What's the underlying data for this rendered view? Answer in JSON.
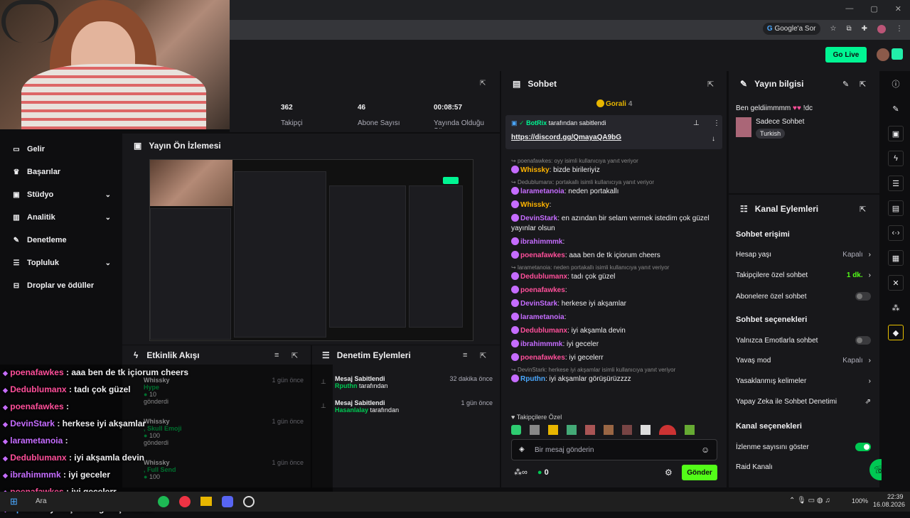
{
  "browser": {
    "search_label": "Google'a Sor",
    "window_icons": [
      "minimize",
      "maximize",
      "close"
    ]
  },
  "header": {
    "go_live": "Go Live"
  },
  "sidebar": {
    "items": [
      {
        "label": "Gelir",
        "icon": "dollar-icon",
        "chev": false
      },
      {
        "label": "Başarılar",
        "icon": "trophy-icon",
        "chev": false
      },
      {
        "label": "Stüdyo",
        "icon": "studio-icon",
        "chev": true
      },
      {
        "label": "Analitik",
        "icon": "chart-icon",
        "chev": true
      },
      {
        "label": "Denetleme",
        "icon": "wrench-icon",
        "chev": false
      },
      {
        "label": "Topluluk",
        "icon": "users-icon",
        "chev": true
      },
      {
        "label": "Droplar ve ödüller",
        "icon": "gift-icon",
        "chev": false
      }
    ]
  },
  "stats": {
    "followers": {
      "value": "362",
      "label": "Takipçi"
    },
    "subs": {
      "value": "46",
      "label": "Abone Sayısı"
    },
    "live": {
      "value": "00:08:57",
      "label": "Yayında Olduğu Süre"
    }
  },
  "preview": {
    "title": "Yayın Ön İzlemesi"
  },
  "activity": {
    "title": "Etkinlik Akışı",
    "items": [
      {
        "user": "Whissky",
        "time": "1 gün önce",
        "sub": "Hype",
        "amount": "10",
        "tail": "gönderdi"
      },
      {
        "user": "Whissky",
        "time": "1 gün önce",
        "sub": ", Skull Emoji",
        "amount": "100",
        "tail": "gönderdi"
      },
      {
        "user": "Whissky",
        "time": "1 gün önce",
        "sub": ", Full Send",
        "amount": "100",
        "tail": ""
      }
    ]
  },
  "modlog": {
    "title": "Denetim Eylemleri",
    "items": [
      {
        "title": "Mesaj Sabitlendi",
        "user": "Rputhn",
        "suffix": "tarafından",
        "time": "32 dakika önce"
      },
      {
        "title": "Mesaj Sabitlendi",
        "user": "Hasanlalay",
        "suffix": "tarafından",
        "time": "1 gün önce"
      }
    ]
  },
  "overlay_chat": [
    {
      "user": "poenafawkes",
      "color": "#ff4f9a",
      "text": ": aaa ben de tk içiorum cheers"
    },
    {
      "user": "Dedublumanx",
      "color": "#ff4f9a",
      "text": ": tadı çok güzel"
    },
    {
      "user": "poenafawkes",
      "color": "#ff4f9a",
      "text": ":"
    },
    {
      "user": "DevinStark",
      "color": "#c56cff",
      "text": ": herkese iyi akşamlar"
    },
    {
      "user": "larametanoia",
      "color": "#c56cff",
      "text": ":"
    },
    {
      "user": "Dedublumanx",
      "color": "#ff4f9a",
      "text": ": iyi akşamla devin"
    },
    {
      "user": "ibrahimmmk",
      "color": "#c56cff",
      "text": ": iyi geceler"
    },
    {
      "user": "poenafawkes",
      "color": "#ff4f9a",
      "text": ": iyi gecelerr"
    },
    {
      "user": "Rputhn",
      "color": "#4aa8ff",
      "text": ": iyi akşamlar görüşürüzzzz"
    }
  ],
  "chat": {
    "title": "Sohbet",
    "gorali": "Gorali",
    "gorali_count": "4",
    "pinned_by": "BotRix",
    "pinned_suffix": "tarafından sabitlendi",
    "pinned_link": "https://discord.gg/QmayaQA9bG",
    "messages": [
      {
        "reply": "poenafawkes: oyy isimli kullanıcıya yanıt veriyor",
        "user": "",
        "text": "",
        "color": "#fff"
      },
      {
        "reply": "",
        "user": "Whissky",
        "text": ": bizde birileriyiz",
        "color": "#ffb400"
      },
      {
        "reply": "Dedublumanx: portakallı isimli kullanıcıya yanıt veriyor",
        "user": "",
        "text": "",
        "color": "#fff"
      },
      {
        "reply": "",
        "user": "larametanoia",
        "text": ": neden portakallı",
        "color": "#c56cff"
      },
      {
        "reply": "",
        "user": "Whissky",
        "text": ":",
        "color": "#ffb400"
      },
      {
        "reply": "",
        "user": "DevinStark",
        "text": ": en azından bir selam vermek istedim çok güzel yayınlar olsun",
        "color": "#c56cff"
      },
      {
        "reply": "",
        "user": "ibrahimmmk",
        "text": ":",
        "color": "#c56cff"
      },
      {
        "reply": "",
        "user": "poenafawkes",
        "text": ": aaa ben de tk içiorum cheers",
        "color": "#ff4f9a"
      },
      {
        "reply": "larametanoia: neden portakallı isimli kullanıcıya yanıt veriyor",
        "user": "",
        "text": "",
        "color": "#fff"
      },
      {
        "reply": "",
        "user": "Dedublumanx",
        "text": ": tadı çok güzel",
        "color": "#ff4f9a"
      },
      {
        "reply": "",
        "user": "poenafawkes",
        "text": ":",
        "color": "#ff4f9a"
      },
      {
        "reply": "",
        "user": "DevinStark",
        "text": ": herkese iyi akşamlar",
        "color": "#c56cff"
      },
      {
        "reply": "",
        "user": "larametanoia",
        "text": ":",
        "color": "#c56cff"
      },
      {
        "reply": "",
        "user": "Dedublumanx",
        "text": ": iyi akşamla devin",
        "color": "#ff4f9a"
      },
      {
        "reply": "",
        "user": "ibrahimmmk",
        "text": ": iyi geceler",
        "color": "#c56cff"
      },
      {
        "reply": "",
        "user": "poenafawkes",
        "text": ": iyi gecelerr",
        "color": "#ff4f9a"
      },
      {
        "reply": "DevinStark: herkese iyi akşamlar isimli kullanıcıya yanıt veriyor",
        "user": "",
        "text": "",
        "color": "#fff"
      },
      {
        "reply": "",
        "user": "Rputhn",
        "text": ": iyi akşamlar görüşürüzzzz",
        "color": "#4aa8ff"
      }
    ],
    "followers_only": "Takipçilere Özel",
    "input_placeholder": "Bir mesaj gönderin",
    "points": "0",
    "send": "Gönder"
  },
  "info": {
    "title": "Yayın bilgisi",
    "stream_title": "Ben geldiimmmm",
    "stream_title_tail": "!dc",
    "category": "Sadece Sohbet",
    "tag": "Turkish"
  },
  "actions": {
    "title": "Kanal Eylemleri",
    "chat_access": "Sohbet erişimi",
    "account_age": "Hesap yaşı",
    "account_age_val": "Kapalı",
    "followers_chat": "Takipçilere özel sohbet",
    "followers_chat_val": "1 dk.",
    "subs_chat": "Abonelere özel sohbet",
    "chat_options": "Sohbet seçenekleri",
    "emote_only": "Yalnızca Emotlarla sohbet",
    "slow_mode": "Yavaş mod",
    "slow_mode_val": "Kapalı",
    "banned_words": "Yasaklanmış kelimeler",
    "ai_mod": "Yapay Zeka ile Sohbet Denetimi",
    "channel_options": "Kanal seçenekleri",
    "show_viewers": "İzlenme sayısını göster",
    "raid": "Raid Kanalı"
  },
  "taskbar": {
    "search": "Ara",
    "battery": "100%",
    "time": "22:39",
    "date": "16.08.2026"
  }
}
